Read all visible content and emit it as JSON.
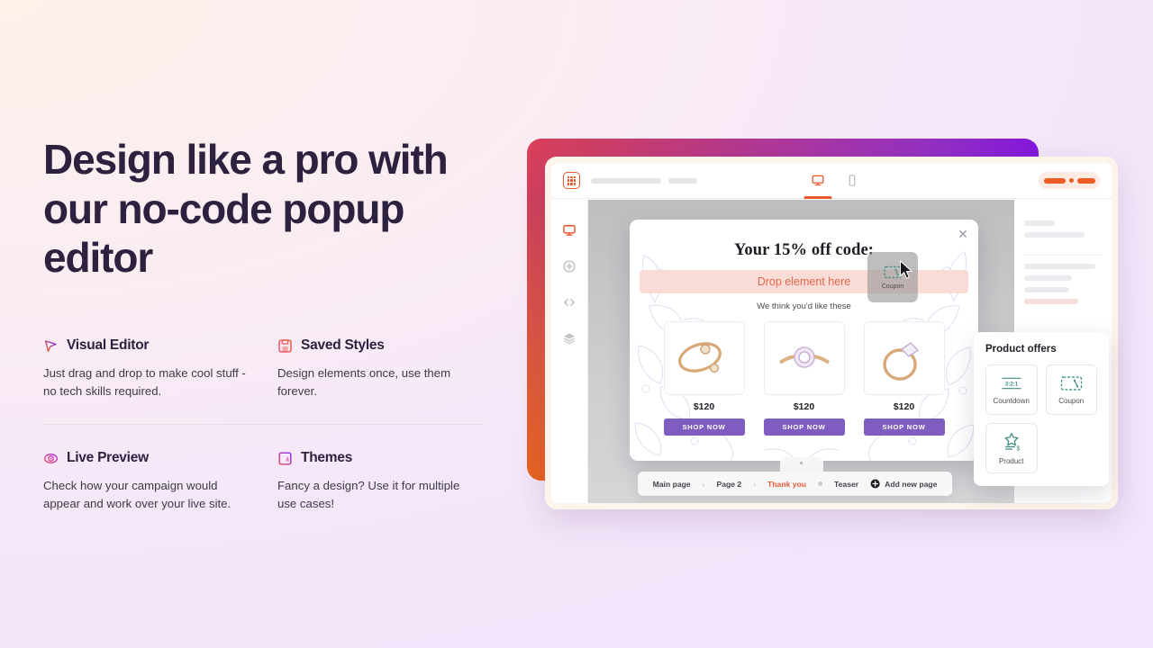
{
  "hero": {
    "headline": "Design like a pro with our no-code popup editor"
  },
  "features": [
    {
      "icon": "cursor-pointer-icon",
      "title": "Visual Editor",
      "desc": "Just drag and drop to make cool stuff - no tech skills required."
    },
    {
      "icon": "floppy-save-icon",
      "title": "Saved Styles",
      "desc": "Design elements once, use them forever."
    },
    {
      "icon": "eye-icon",
      "title": "Live Preview",
      "desc": "Check how your campaign would appear and work over your live site."
    },
    {
      "icon": "palette-book-icon",
      "title": "Themes",
      "desc": "Fancy a design? Use it for multiple use cases!"
    }
  ],
  "editor": {
    "toolbar": {
      "logo_icon": "app-grid-logo-icon",
      "device_tabs": [
        {
          "icon": "desktop-monitor-icon",
          "active": true
        },
        {
          "icon": "mobile-phone-icon",
          "active": false
        }
      ]
    },
    "sidebar_icons": [
      "display-monitor-icon",
      "plus-circle-icon",
      "code-brackets-icon",
      "layers-icon"
    ],
    "popup": {
      "close_icon": "close-x-icon",
      "title": "Your 15% off code:",
      "dropzone_text": "Drop element here",
      "subtitle": "We think you'd like these",
      "products": [
        {
          "price": "$120",
          "button": "SHOP NOW"
        },
        {
          "price": "$120",
          "button": "SHOP NOW"
        },
        {
          "price": "$120",
          "button": "SHOP NOW"
        }
      ]
    },
    "drag_ghost": {
      "label": "Coupon",
      "icon": "coupon-ticket-icon"
    },
    "offers_panel": {
      "title": "Product offers",
      "items": [
        {
          "label": "Countdown",
          "icon": "countdown-timer-icon",
          "badge": "3:2:1"
        },
        {
          "label": "Coupon",
          "icon": "coupon-ticket-icon"
        },
        {
          "label": "Product",
          "icon": "product-star-icon"
        }
      ]
    },
    "page_bar": {
      "collapse_icon": "chevron-up-icon",
      "pages": [
        "Main page",
        "Page 2",
        "Thank you"
      ],
      "active_page": "Thank you",
      "teaser_label": "Teaser",
      "add_label": "Add new page",
      "add_icon": "plus-filled-icon",
      "separator": "›"
    }
  },
  "colors": {
    "accent_orange": "#e8572a",
    "accent_purple": "#7e5cc0",
    "headline": "#2d2140",
    "dropzone_bg": "#fadcd6",
    "gradient_start": "#d9405a",
    "gradient_end": "#7c0ff0"
  }
}
